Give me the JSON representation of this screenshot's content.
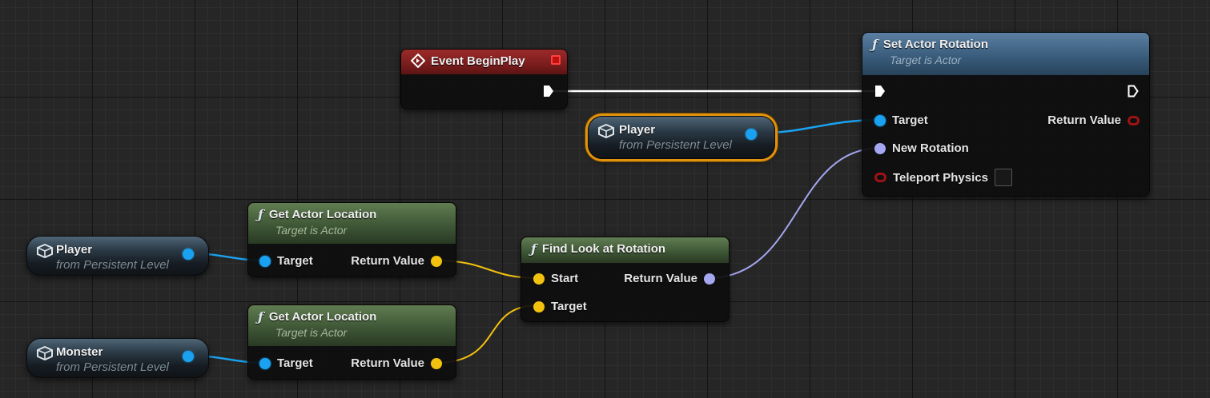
{
  "nodes": {
    "event_begin_play": {
      "title": "Event BeginPlay"
    },
    "set_actor_rotation": {
      "title": "Set Actor Rotation",
      "subtitle": "Target is Actor",
      "pins": {
        "target": "Target",
        "new_rotation": "New Rotation",
        "teleport_physics": "Teleport Physics",
        "return_value": "Return Value"
      }
    },
    "player_ref_top": {
      "name": "Player",
      "sub": "from Persistent Level"
    },
    "get_actor_location_1": {
      "title": "Get Actor Location",
      "subtitle": "Target is Actor",
      "pins": {
        "target": "Target",
        "return_value": "Return Value"
      }
    },
    "get_actor_location_2": {
      "title": "Get Actor Location",
      "subtitle": "Target is Actor",
      "pins": {
        "target": "Target",
        "return_value": "Return Value"
      }
    },
    "find_look_at_rotation": {
      "title": "Find Look at Rotation",
      "pins": {
        "start": "Start",
        "target": "Target",
        "return_value": "Return Value"
      }
    },
    "player_ref_left": {
      "name": "Player",
      "sub": "from Persistent Level"
    },
    "monster_ref": {
      "name": "Monster",
      "sub": "from Persistent Level"
    }
  },
  "colors": {
    "object_pin": "#1aa1f0",
    "vector_pin": "#f3c20f",
    "rotator_pin": "#a5a7f1",
    "bool_pin": "#a01313",
    "exec_wire": "#ffffff",
    "selection": "#e1920f"
  }
}
